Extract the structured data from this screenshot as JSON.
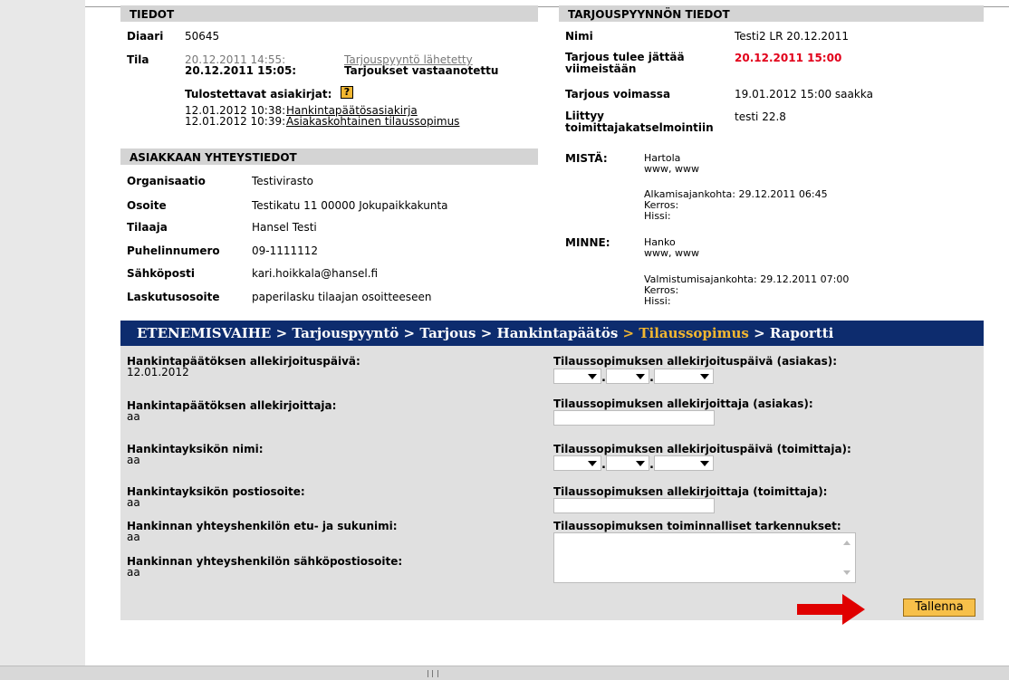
{
  "tiedot": {
    "header": "TIEDOT",
    "diaari_label": "Diaari",
    "diaari_value": "50645",
    "tila_label": "Tila",
    "tila_time1": "20.12.2011 14:55:",
    "tila_status1": "Tarjouspyyntö lähetetty",
    "tila_time2": "20.12.2011 15:05:",
    "tila_status2": "Tarjoukset vastaanotettu",
    "docs_label": "Tulostettavat asiakirjat:",
    "help_icon": "?",
    "doc1_time": "12.01.2012 10:38:",
    "doc1_link": "Hankintapäätösasiakirja",
    "doc2_time": "12.01.2012 10:39:",
    "doc2_link": "Asiakaskohtainen tilaussopimus"
  },
  "tarjouspyynto": {
    "header": "TARJOUSPYYNNÖN TIEDOT",
    "nimi_label": "Nimi",
    "nimi_value": "Testi2 LR 20.12.2011",
    "deadline_label_1": "Tarjous tulee jättää",
    "deadline_label_2": "viimeistään",
    "deadline_value": "20.12.2011 15:00",
    "voimassa_label": "Tarjous voimassa",
    "voimassa_value": "19.01.2012 15:00 saakka",
    "liittyy_label_1": "Liittyy",
    "liittyy_label_2": "toimittajakatselmointiin",
    "liittyy_value": "testi 22.8",
    "mista_label": "MISTÄ:",
    "mista_city": "Hartola",
    "mista_web": "www, www",
    "mista_start": "Alkamisajankohta: 29.12.2011 06:45",
    "mista_kerros": "Kerros:",
    "mista_hissi": "Hissi:",
    "minne_label": "MINNE:",
    "minne_city": "Hanko",
    "minne_web": "www, www",
    "minne_end": "Valmistumisajankohta: 29.12.2011 07:00",
    "minne_kerros": "Kerros:",
    "minne_hissi": "Hissi:"
  },
  "asiakas": {
    "header": "ASIAKKAAN YHTEYSTIEDOT",
    "rows": [
      {
        "label": "Organisaatio",
        "value": "Testivirasto"
      },
      {
        "label": "Osoite",
        "value": "Testikatu 11 00000 Jokupaikkakunta"
      },
      {
        "label": "Tilaaja",
        "value": "Hansel Testi"
      },
      {
        "label": "Puhelinnumero",
        "value": "09-1111112"
      },
      {
        "label": "Sähköposti",
        "value": "kari.hoikkala@hansel.fi"
      },
      {
        "label": "Laskutusosoite",
        "value": "paperilasku tilaajan osoitteeseen"
      }
    ]
  },
  "nav": {
    "prefix": "ETENEMISVAIHE",
    "sep": ">",
    "step1": "Tarjouspyyntö",
    "step2": "Tarjous",
    "step3": "Hankintapäätös",
    "step4_current": "Tilaussopimus",
    "step5": "Raportti"
  },
  "form": {
    "left": [
      {
        "label": "Hankintapäätöksen allekirjoituspäivä:",
        "value": "12.01.2012"
      },
      {
        "label": "Hankintapäätöksen allekirjoittaja:",
        "value": "aa"
      },
      {
        "label": "Hankintayksikön nimi:",
        "value": "aa"
      },
      {
        "label": "Hankintayksikön postiosoite:",
        "value": "aa"
      },
      {
        "label": "Hankinnan yhteyshenkilön etu- ja sukunimi:",
        "value": "aa"
      },
      {
        "label": "Hankinnan yhteyshenkilön sähköpostiosoite:",
        "value": "aa"
      }
    ],
    "right": {
      "sign_date_customer": "Tilaussopimuksen allekirjoituspäivä (asiakas):",
      "signer_customer": "Tilaussopimuksen allekirjoittaja (asiakas):",
      "sign_date_supplier": "Tilaussopimuksen allekirjoituspäivä (toimittaja):",
      "signer_supplier": "Tilaussopimuksen allekirjoittaja (toimittaja):",
      "refinements": "Tilaussopimuksen toiminnalliset tarkennukset:"
    },
    "date_separator": ".",
    "save_button": "Tallenna"
  },
  "colors": {
    "nav_bg": "#0d2c6e",
    "nav_current": "#f2b731",
    "deadline_red": "#e2001a",
    "button_bg": "#f7c04a",
    "arrow_red": "#e00000"
  }
}
